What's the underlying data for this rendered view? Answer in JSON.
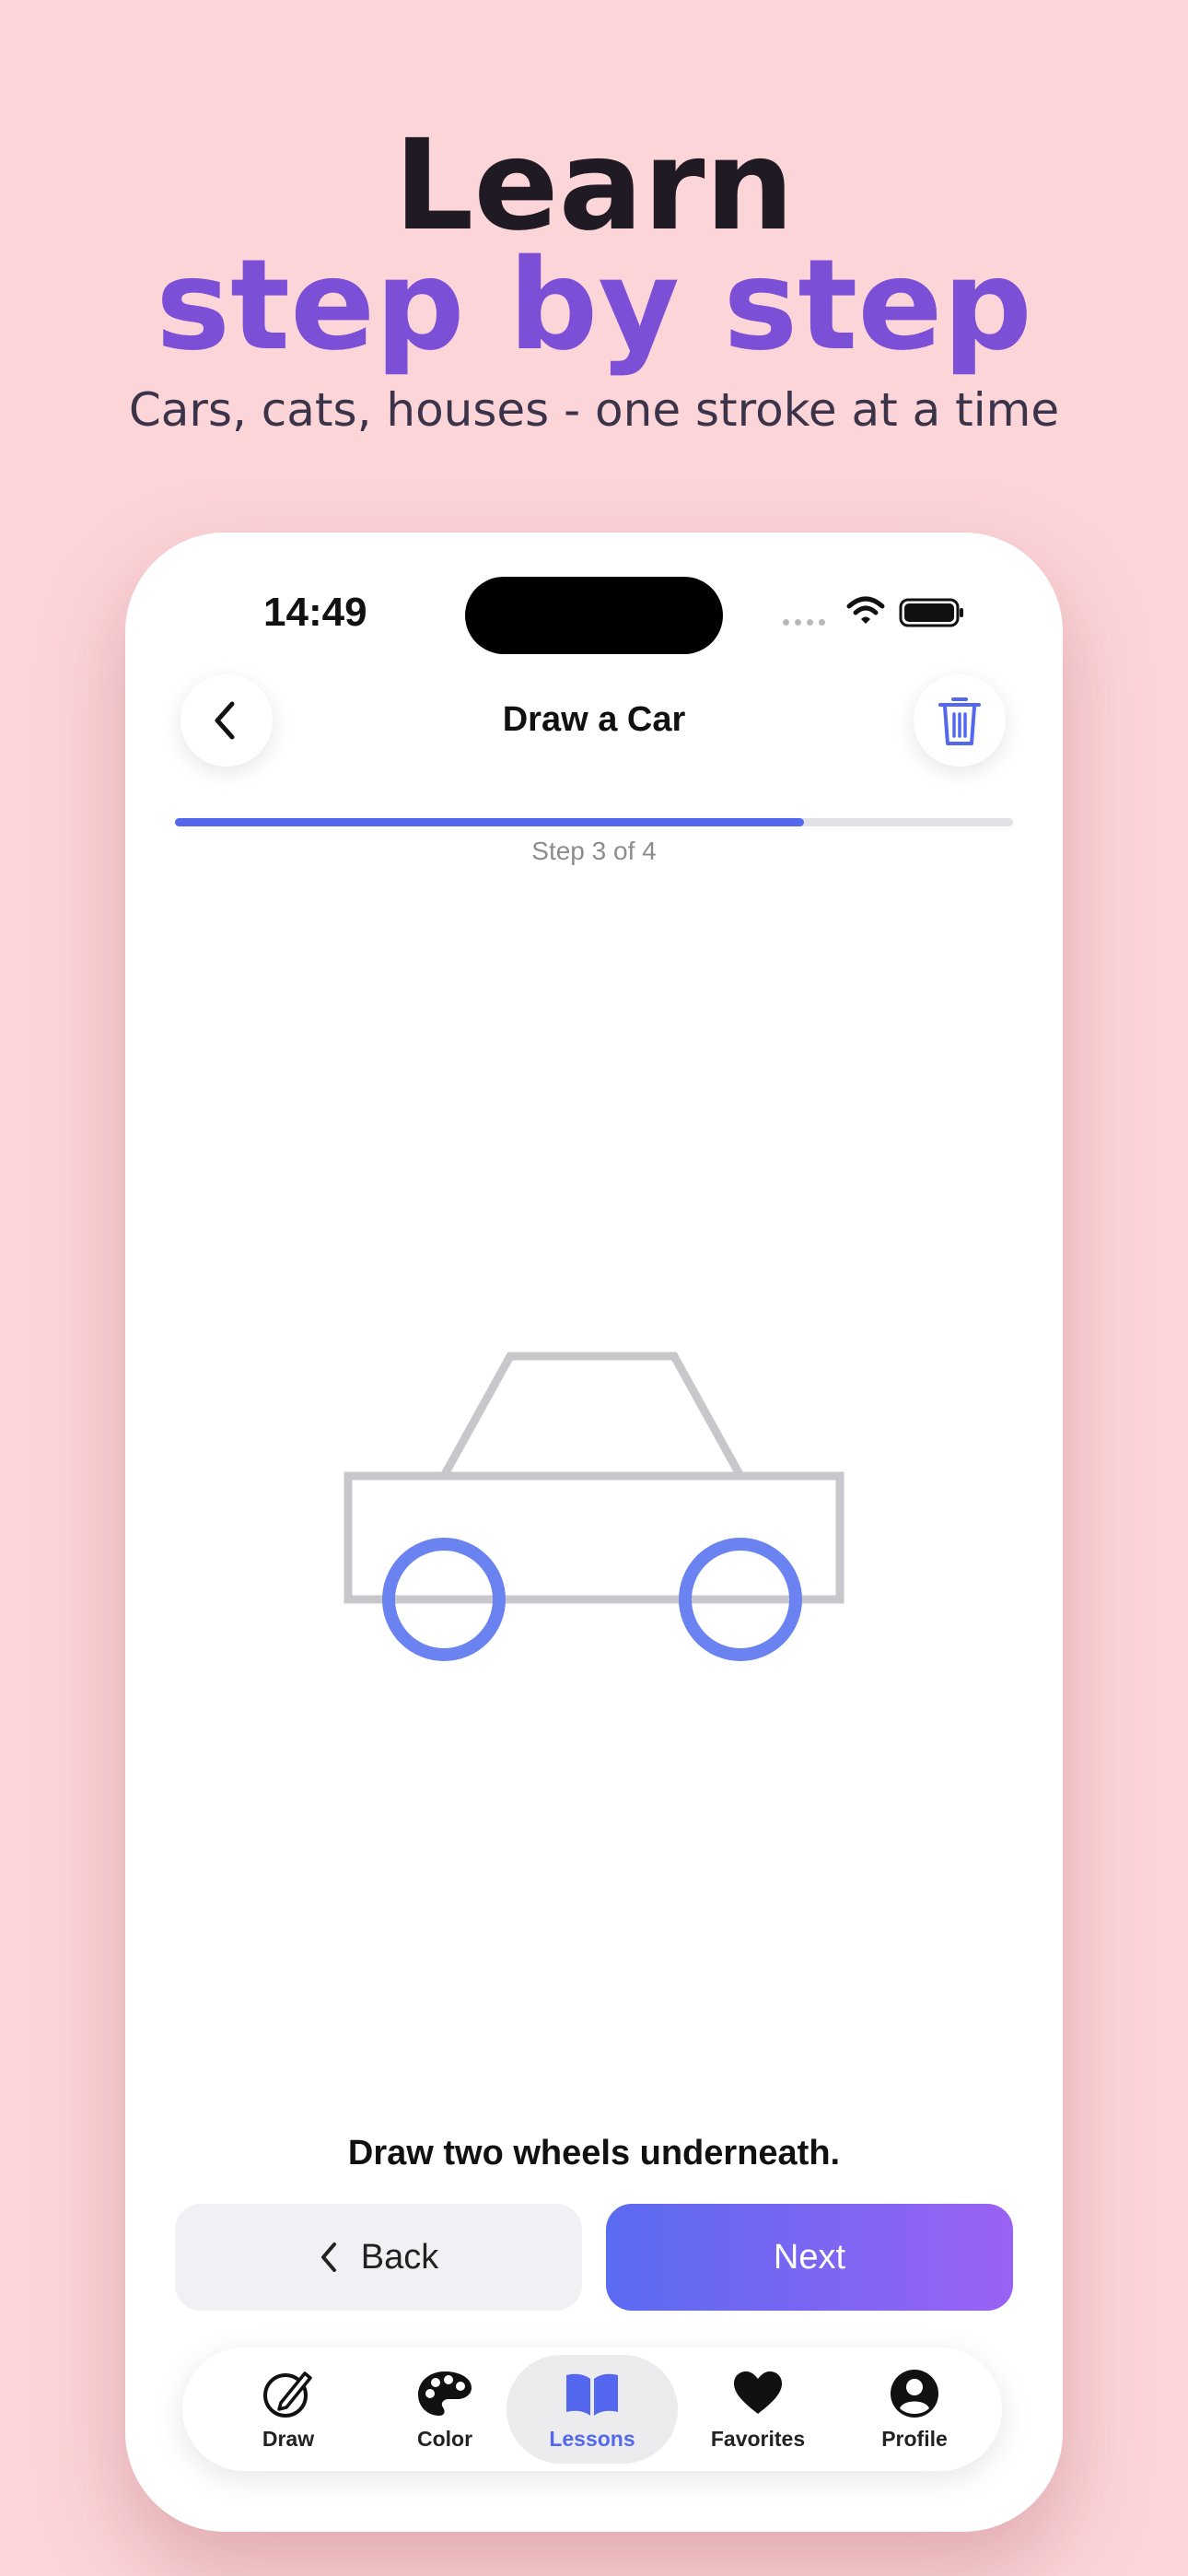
{
  "promo": {
    "line1": "Learn",
    "line2": "step by step",
    "subtitle": "Cars, cats, houses - one stroke at a time"
  },
  "status_bar": {
    "time": "14:49",
    "icons": [
      "cellular-signal-icon",
      "wifi-icon",
      "battery-icon"
    ]
  },
  "header": {
    "title": "Draw a Car",
    "back_icon": "chevron-left-icon",
    "trash_icon": "trash-icon"
  },
  "progress": {
    "label": "Step 3 of 4",
    "fraction": 0.75
  },
  "canvas": {
    "subject": "car outline",
    "guide_color": "#c8c8cc",
    "active_step_color": "#6a83f0"
  },
  "instruction": "Draw two wheels underneath.",
  "buttons": {
    "back_label": "Back",
    "next_label": "Next"
  },
  "tabbar": {
    "active": "Lessons",
    "accent": "#5468ef",
    "tabs": [
      {
        "label": "Draw",
        "icon": "pencil-circle-icon"
      },
      {
        "label": "Color",
        "icon": "palette-icon"
      },
      {
        "label": "Lessons",
        "icon": "book-icon"
      },
      {
        "label": "Favorites",
        "icon": "heart-icon"
      },
      {
        "label": "Profile",
        "icon": "person-circle-icon"
      }
    ]
  }
}
